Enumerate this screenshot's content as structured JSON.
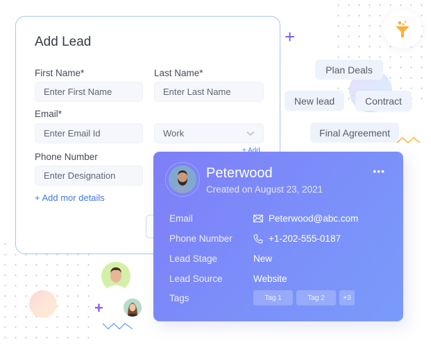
{
  "form": {
    "title": "Add Lead",
    "first_name": {
      "label": "First Name*",
      "placeholder": "Enter First Name"
    },
    "last_name": {
      "label": "Last Name*",
      "placeholder": "Enter Last Name"
    },
    "email": {
      "label": "Email*",
      "placeholder": "Enter Email Id"
    },
    "email_type": {
      "value": "Work",
      "add_label": "+ Add"
    },
    "phone": {
      "label": "Phone Number",
      "placeholder": "Enter Designation"
    },
    "add_more_label": "+ Add mor details"
  },
  "lead_card": {
    "name": "Peterwood",
    "created": "Created on August 23, 2021",
    "more_label": "•••",
    "rows": [
      {
        "label": "Email",
        "value": "Peterwood@abc.com",
        "icon": "mail-icon"
      },
      {
        "label": "Phone Number",
        "value": "+1-202-555-0187",
        "icon": "phone-icon"
      },
      {
        "label": "Lead Stage",
        "value": "New"
      },
      {
        "label": "Lead Source",
        "value": "Website"
      },
      {
        "label": "Tags"
      }
    ],
    "tags": [
      "Tag 1",
      "Tag 2",
      "+3"
    ]
  },
  "pipeline_chips": {
    "plan": "Plan Deals",
    "new": "New lead",
    "contract": "Contract",
    "final": "Final Agreement"
  },
  "decor": {
    "plus": "+",
    "accent": "#6f5cf0",
    "card_gradient": [
      "#7f7ef8",
      "#7a9bfb"
    ],
    "funnel_color": "#fbb03b"
  }
}
